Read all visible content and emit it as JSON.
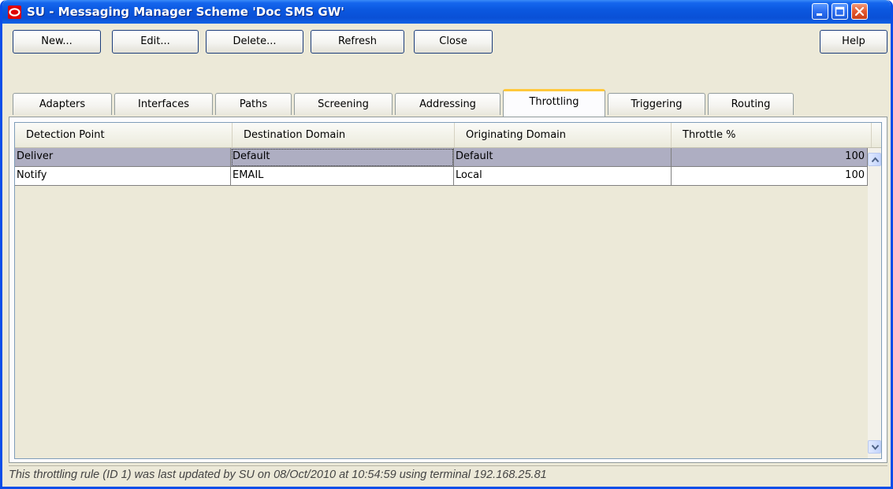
{
  "window": {
    "title": "SU - Messaging Manager Scheme 'Doc SMS GW'"
  },
  "toolbar": {
    "new_label": "New...",
    "edit_label": "Edit...",
    "delete_label": "Delete...",
    "refresh_label": "Refresh",
    "close_label": "Close",
    "help_label": "Help"
  },
  "tabs": [
    {
      "label": "Adapters"
    },
    {
      "label": "Interfaces"
    },
    {
      "label": "Paths"
    },
    {
      "label": "Screening"
    },
    {
      "label": "Addressing"
    },
    {
      "label": "Throttling",
      "active": true
    },
    {
      "label": "Triggering"
    },
    {
      "label": "Routing"
    }
  ],
  "table": {
    "columns": [
      "Detection Point",
      "Destination Domain",
      "Originating Domain",
      "Throttle %"
    ],
    "rows": [
      [
        "Deliver",
        "Default",
        "Default",
        "100"
      ],
      [
        "Notify",
        "EMAIL",
        "Local",
        "100"
      ]
    ]
  },
  "status": {
    "text": "This throttling rule (ID 1) was last updated by SU on 08/Oct/2010 at 10:54:59 using terminal 192.168.25.81"
  },
  "icons": {
    "app": "oracle-logo-icon",
    "minimize": "minimize-icon",
    "maximize": "maximize-icon",
    "close": "close-icon",
    "scroll_up": "scroll-up-arrow-icon",
    "scroll_down": "scroll-down-arrow-icon"
  },
  "colors": {
    "titlebar": "#0a50d6",
    "selected_row": "#aeaec2",
    "active_tab_accent": "#ffc83c",
    "close_button": "#e4582e"
  }
}
